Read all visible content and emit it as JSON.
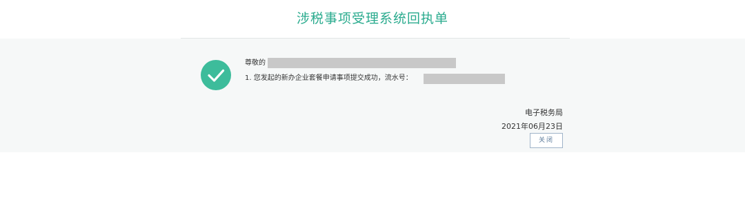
{
  "header": {
    "title": "涉税事项受理系统回执单",
    "title_color": "#2aab8e"
  },
  "receipt": {
    "status_icon": "check-circle-icon",
    "accent_color": "#3dbc9b",
    "greeting": "尊敬的",
    "message": "1. 您发起的新办企业套餐申请事项提交成功，流水号：",
    "issuer": "电子税务局",
    "date": "2021年06月23日",
    "close_label": "关闭"
  }
}
